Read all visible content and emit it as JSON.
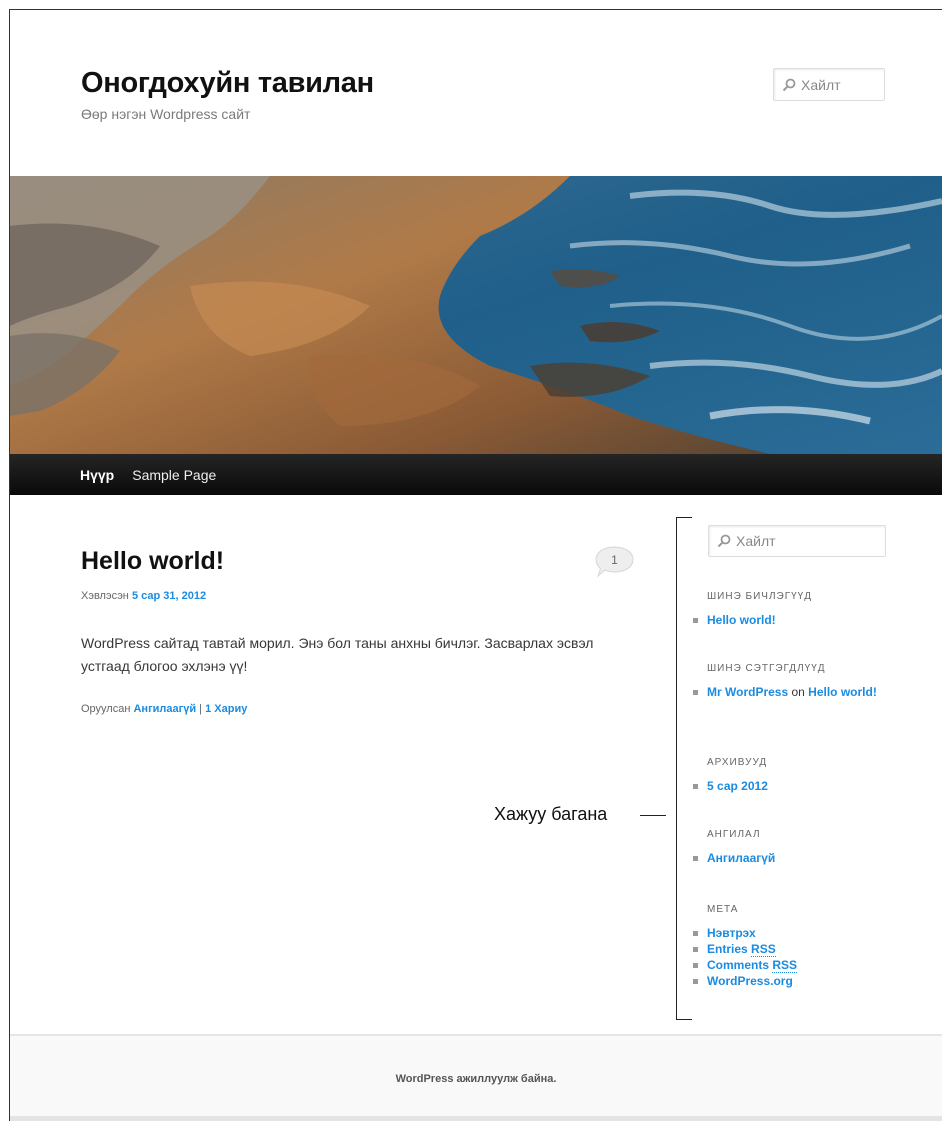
{
  "site": {
    "title": "Оногдохуйн тавилан",
    "description": "Өөр нэгэн Wordpress сайт"
  },
  "header_search": {
    "placeholder": "Хайлт"
  },
  "nav": {
    "items": [
      "Нүүр",
      "Sample Page"
    ],
    "current": "Нүүр"
  },
  "post": {
    "title": "Hello world!",
    "comment_count": "1",
    "meta_prefix": "Хэвлэсэн ",
    "meta_date": "5 сар 31, 2012",
    "body": "WordPress сайтад тавтай морил. Энэ бол таны анхны бичлэг. Засварлах эсвэл устгаад блогоо эхлэнэ үү!",
    "foot_prefix": "Оруулсан ",
    "category": "Ангилаагүй",
    "separator": " | ",
    "reply": "1 Хариу"
  },
  "sidebar": {
    "search_placeholder": "Хайлт",
    "recent_posts": {
      "title": "ШИНЭ БИЧЛЭГҮҮД",
      "items": [
        "Hello world!"
      ]
    },
    "recent_comments": {
      "title": "ШИНЭ СЭТГЭГДЛҮҮД",
      "author": "Mr WordPress",
      "on": " on ",
      "post": "Hello world!"
    },
    "archives": {
      "title": "АРХИВУУД",
      "items": [
        "5 сар 2012"
      ]
    },
    "categories": {
      "title": "АНГИЛАЛ",
      "items": [
        "Ангилаагүй"
      ]
    },
    "meta": {
      "title": "МЕТА",
      "login": "Нэвтрэх",
      "entries": "Entries",
      "comments": "Comments",
      "rss": "RSS",
      "wporg": "WordPress.org"
    }
  },
  "annotation": "Хажуу багана",
  "footer": {
    "text": "WordPress ажиллуулж байна."
  },
  "colors": {
    "link": "#1b8be0",
    "nav_bg": "#0a0a0a"
  },
  "icons": [
    "search-icon",
    "comment-bubble-icon"
  ]
}
